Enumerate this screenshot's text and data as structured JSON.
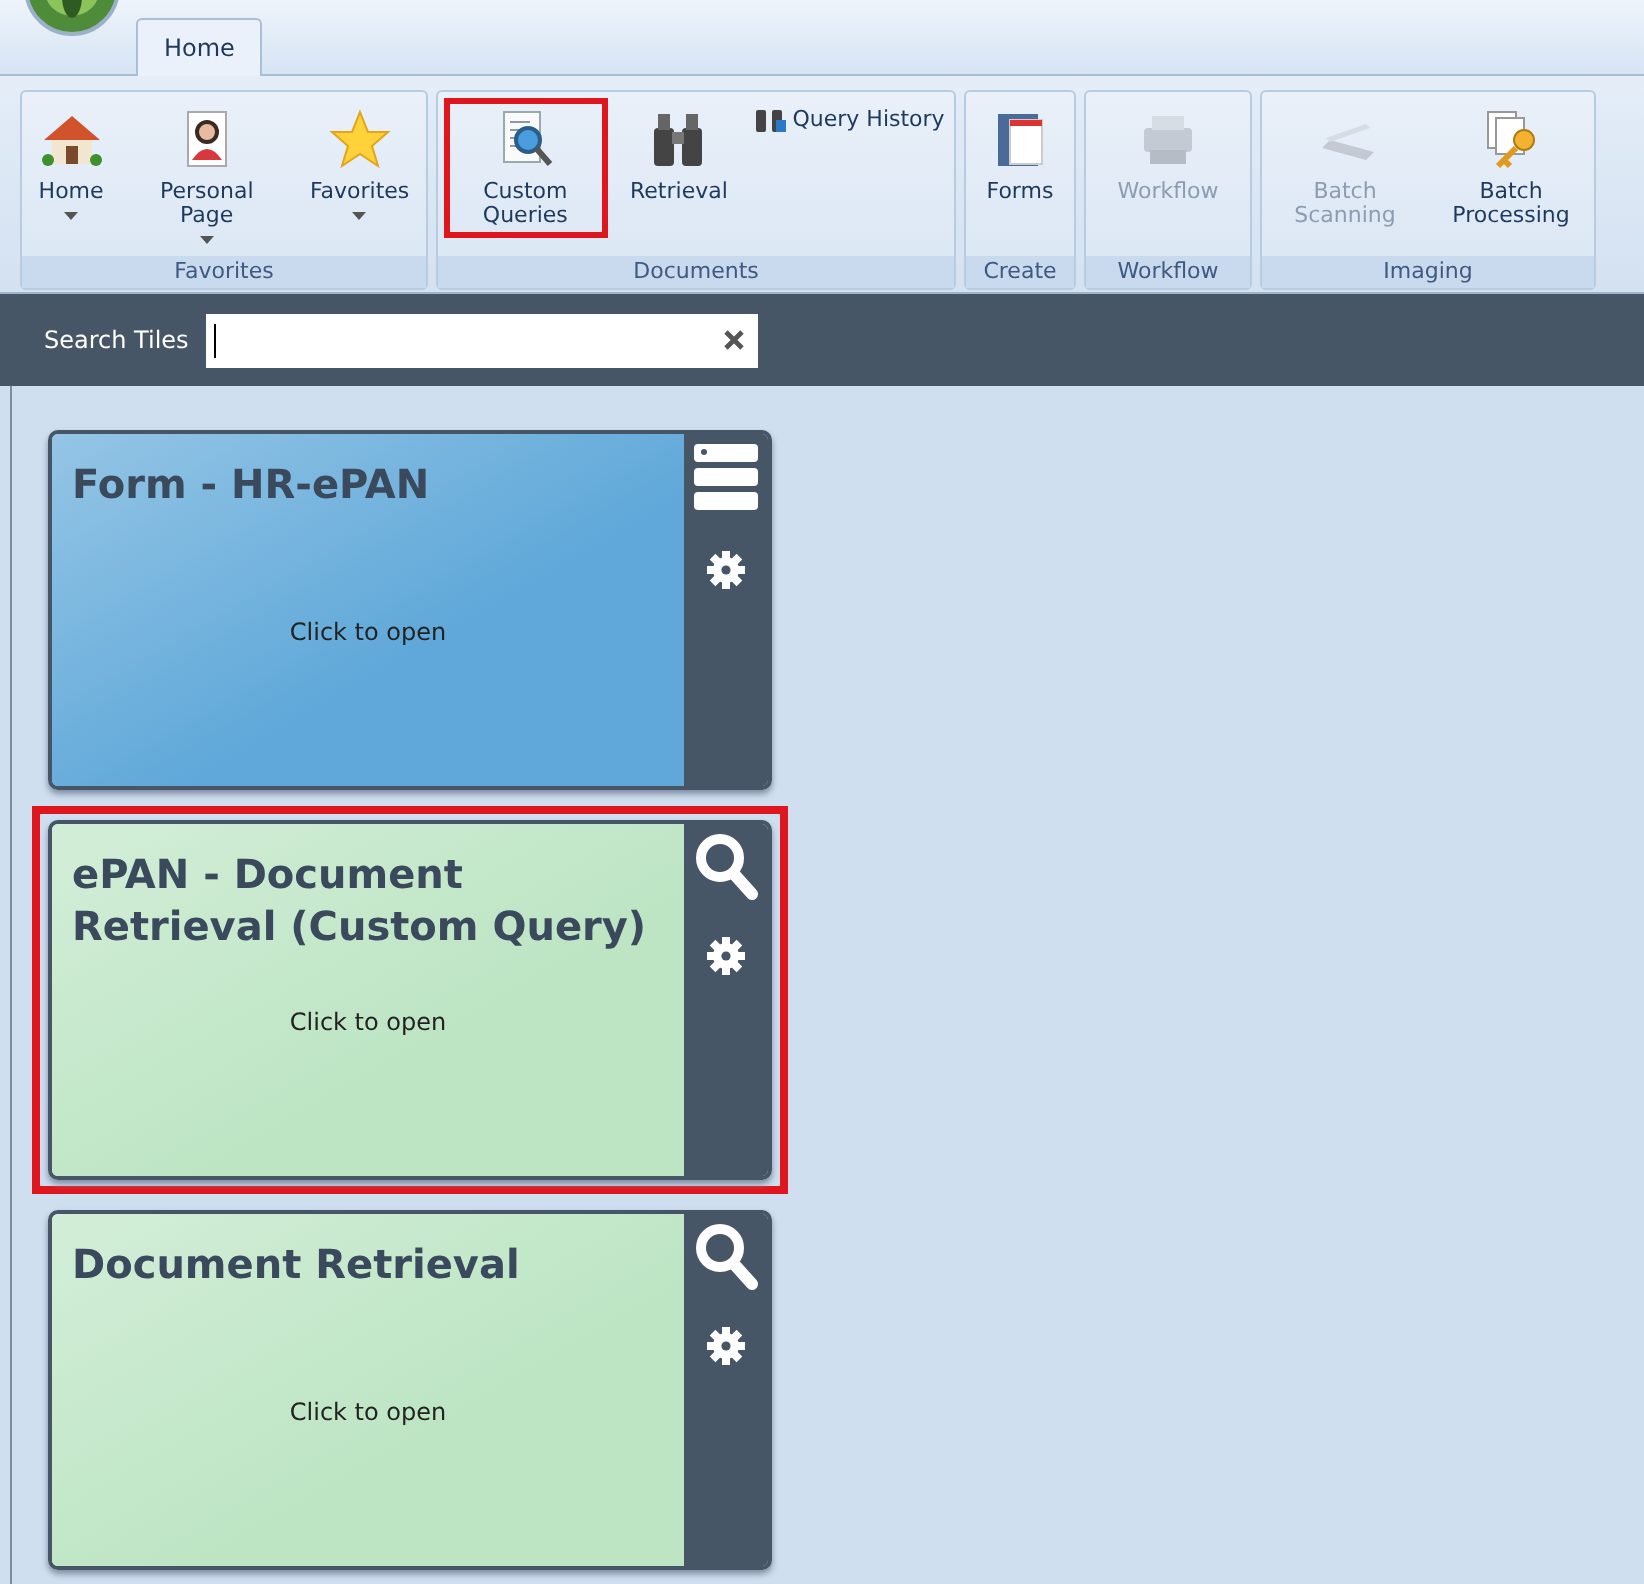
{
  "ribbon": {
    "tabs": [
      {
        "label": "Home",
        "selected": true
      }
    ],
    "groups": [
      {
        "label": "Favorites",
        "buttons": [
          {
            "label": "Home",
            "kind": "large",
            "dropdown": true,
            "disabled": false,
            "highlighted": false
          },
          {
            "label": "Personal Page",
            "kind": "large",
            "dropdown": true,
            "disabled": false,
            "highlighted": false
          },
          {
            "label": "Favorites",
            "kind": "large",
            "dropdown": true,
            "disabled": false,
            "highlighted": false
          }
        ]
      },
      {
        "label": "Documents",
        "buttons": [
          {
            "label": "Custom Queries",
            "kind": "large",
            "dropdown": false,
            "disabled": false,
            "highlighted": true
          },
          {
            "label": "Retrieval",
            "kind": "large",
            "dropdown": false,
            "disabled": false,
            "highlighted": false
          },
          {
            "label": "Query History",
            "kind": "small"
          }
        ]
      },
      {
        "label": "Create",
        "buttons": [
          {
            "label": "Forms",
            "kind": "large",
            "dropdown": false,
            "disabled": false,
            "highlighted": false
          }
        ]
      },
      {
        "label": "Workflow",
        "buttons": [
          {
            "label": "Workflow",
            "kind": "large",
            "dropdown": false,
            "disabled": true,
            "highlighted": false
          }
        ]
      },
      {
        "label": "Imaging",
        "buttons": [
          {
            "label": "Batch Scanning",
            "kind": "large",
            "dropdown": false,
            "disabled": true,
            "highlighted": false
          },
          {
            "label": "Batch Processing",
            "kind": "large",
            "dropdown": false,
            "disabled": false,
            "highlighted": false
          }
        ]
      }
    ]
  },
  "search": {
    "label": "Search Tiles"
  },
  "tiles": [
    {
      "title": "Form - HR-ePAN",
      "subtitle": "Click to open",
      "kind": "form",
      "color": "#5fa8d9",
      "highlighted": false
    },
    {
      "title": "ePAN - Document Retrieval (Custom Query)",
      "subtitle": "Click to open",
      "kind": "query",
      "color": "#bde5c4",
      "highlighted": true
    },
    {
      "title": "Document Retrieval",
      "subtitle": "Click to open",
      "kind": "query",
      "color": "#bde5c4",
      "highlighted": false
    }
  ]
}
